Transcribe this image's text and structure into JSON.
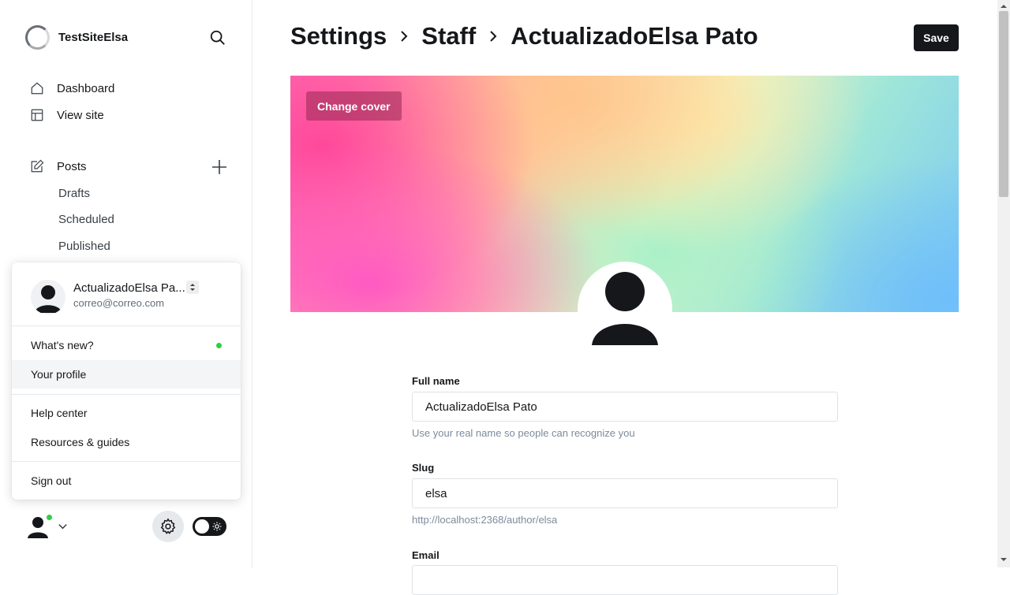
{
  "site": {
    "name": "TestSiteElsa"
  },
  "nav": {
    "dashboard": "Dashboard",
    "view_site": "View site",
    "posts": "Posts",
    "drafts": "Drafts",
    "scheduled": "Scheduled",
    "published": "Published"
  },
  "user_menu": {
    "name": "ActualizadoElsa Pa...",
    "email": "correo@correo.com",
    "items": {
      "whats_new": "What's new?",
      "your_profile": "Your profile",
      "help_center": "Help center",
      "resources": "Resources & guides",
      "sign_out": "Sign out"
    }
  },
  "header": {
    "crumb_settings": "Settings",
    "crumb_staff": "Staff",
    "crumb_user": "ActualizadoElsa Pato",
    "save_label": "Save"
  },
  "cover": {
    "change_label": "Change cover"
  },
  "form": {
    "full_name": {
      "label": "Full name",
      "value": "ActualizadoElsa Pato",
      "hint": "Use your real name so people can recognize you"
    },
    "slug": {
      "label": "Slug",
      "value": "elsa",
      "hint": "http://localhost:2368/author/elsa"
    },
    "email": {
      "label": "Email"
    }
  },
  "colors": {
    "accent_dark": "#15171a",
    "status_green": "#30cf43"
  }
}
